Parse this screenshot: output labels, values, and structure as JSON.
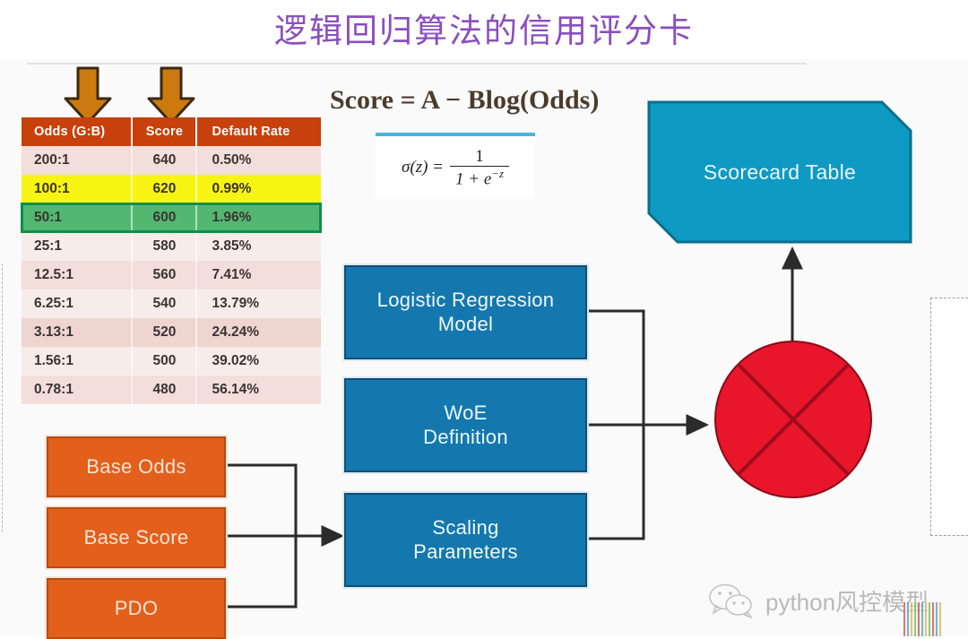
{
  "slide": {
    "title": "逻辑回归算法的信用评分卡"
  },
  "table": {
    "headers": [
      "Odds (G:B)",
      "Score",
      "Default Rate"
    ],
    "rows": [
      {
        "odds": "200:1",
        "score": "640",
        "rate": "0.50%",
        "highlight": "none"
      },
      {
        "odds": "100:1",
        "score": "620",
        "rate": "0.99%",
        "highlight": "yellow"
      },
      {
        "odds": "50:1",
        "score": "600",
        "rate": "1.96%",
        "highlight": "green"
      },
      {
        "odds": "25:1",
        "score": "580",
        "rate": "3.85%",
        "highlight": "none"
      },
      {
        "odds": "12.5:1",
        "score": "560",
        "rate": "7.41%",
        "highlight": "none"
      },
      {
        "odds": "6.25:1",
        "score": "540",
        "rate": "13.79%",
        "highlight": "none"
      },
      {
        "odds": "3.13:1",
        "score": "520",
        "rate": "24.24%",
        "highlight": "none"
      },
      {
        "odds": "1.56:1",
        "score": "500",
        "rate": "39.02%",
        "highlight": "none"
      },
      {
        "odds": "0.78:1",
        "score": "480",
        "rate": "56.14%",
        "highlight": "none"
      }
    ],
    "header_color": "#c8400b",
    "highlight_yellow": "#f7f413",
    "highlight_green": "#52b871"
  },
  "arrows": {
    "odds_column_pointer": "down-arrow-icon",
    "score_column_pointer": "down-arrow-icon",
    "color": "#cc7a10"
  },
  "formula": {
    "score_equation": "Score = A − Blog(Odds)",
    "sigmoid": {
      "lhs": "σ(z) =",
      "numerator": "1",
      "denominator_base": "1 + e",
      "denominator_exponent": "−z"
    },
    "accent_color": "#44b6e0"
  },
  "process_boxes": [
    {
      "label": "Logistic Regression\nModel",
      "line1": "Logistic Regression",
      "line2": "Model"
    },
    {
      "label": "WoE Definition",
      "line1": "WoE",
      "line2": "Definition"
    },
    {
      "label": "Scaling Parameters",
      "line1": "Scaling",
      "line2": "Parameters"
    }
  ],
  "input_boxes": [
    {
      "label": "Base Odds"
    },
    {
      "label": "Base Score"
    },
    {
      "label": "PDO"
    }
  ],
  "output_box": {
    "label": "Scorecard Table",
    "color": "#0f9ac4"
  },
  "merge_node": {
    "name": "cross-circle-node",
    "color": "#e8152b"
  },
  "colors": {
    "blue_box": "#1478ae",
    "orange_box": "#e2601b",
    "title_purple": "#8a4fbe",
    "panel_background": "#fafafa"
  },
  "watermark": {
    "text": "python风控模型",
    "icon": "wechat-icon"
  }
}
